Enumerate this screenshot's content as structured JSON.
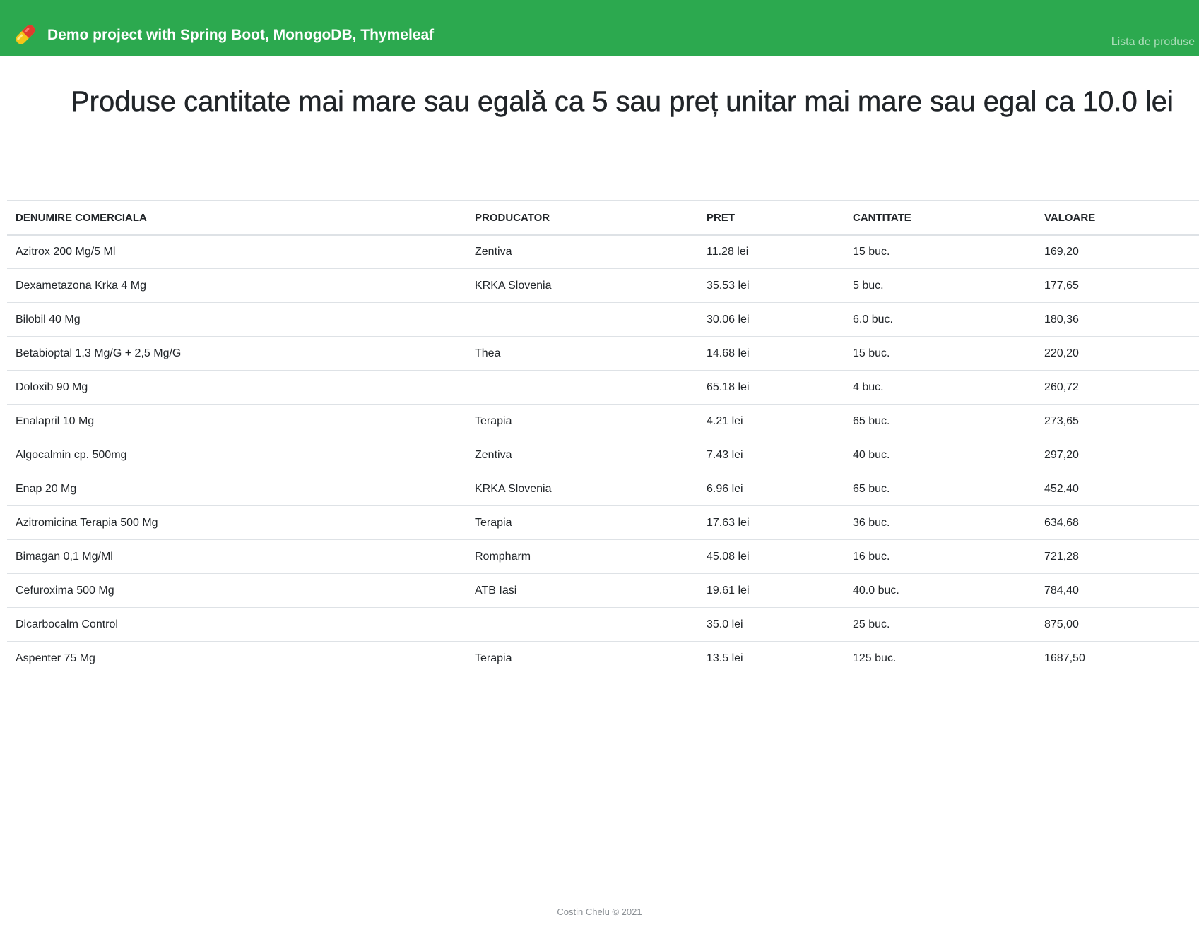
{
  "navbar": {
    "brand_icon": "pill-capsule-icon",
    "title": "Demo project with Spring Boot, MonogoDB, Thymeleaf",
    "link_label": "Lista de produse",
    "color": "#2ca94f"
  },
  "heading": "Produse cantitate mai mare sau egală ca 5 sau preț unitar mai mare sau egal ca 10.0 lei",
  "table": {
    "headers": {
      "name": "DENUMIRE COMERCIALA",
      "producer": "PRODUCATOR",
      "price": "PRET",
      "quantity": "CANTITATE",
      "value": "VALOARE"
    },
    "rows": [
      {
        "name": "Azitrox 200 Mg/5 Ml",
        "producer": "Zentiva",
        "price": "11.28 lei",
        "quantity": "15 buc.",
        "value": "169,20"
      },
      {
        "name": "Dexametazona Krka 4 Mg",
        "producer": "KRKA Slovenia",
        "price": "35.53 lei",
        "quantity": "5 buc.",
        "value": "177,65"
      },
      {
        "name": "Bilobil 40 Mg",
        "producer": "",
        "price": "30.06 lei",
        "quantity": "6.0 buc.",
        "value": "180,36"
      },
      {
        "name": "Betabioptal 1,3 Mg/G + 2,5 Mg/G",
        "producer": "Thea",
        "price": "14.68 lei",
        "quantity": "15 buc.",
        "value": "220,20"
      },
      {
        "name": "Doloxib 90 Mg",
        "producer": "",
        "price": "65.18 lei",
        "quantity": "4 buc.",
        "value": "260,72"
      },
      {
        "name": "Enalapril 10 Mg",
        "producer": "Terapia",
        "price": "4.21 lei",
        "quantity": "65 buc.",
        "value": "273,65"
      },
      {
        "name": "Algocalmin cp. 500mg",
        "producer": "Zentiva",
        "price": "7.43 lei",
        "quantity": "40 buc.",
        "value": "297,20"
      },
      {
        "name": "Enap 20 Mg",
        "producer": "KRKA Slovenia",
        "price": "6.96 lei",
        "quantity": "65 buc.",
        "value": "452,40"
      },
      {
        "name": "Azitromicina Terapia 500 Mg",
        "producer": "Terapia",
        "price": "17.63 lei",
        "quantity": "36 buc.",
        "value": "634,68"
      },
      {
        "name": "Bimagan 0,1 Mg/Ml",
        "producer": "Rompharm",
        "price": "45.08 lei",
        "quantity": "16 buc.",
        "value": "721,28"
      },
      {
        "name": "Cefuroxima 500 Mg",
        "producer": "ATB Iasi",
        "price": "19.61 lei",
        "quantity": "40.0 buc.",
        "value": "784,40"
      },
      {
        "name": "Dicarbocalm Control",
        "producer": "",
        "price": "35.0 lei",
        "quantity": "25 buc.",
        "value": "875,00"
      },
      {
        "name": "Aspenter 75 Mg",
        "producer": "Terapia",
        "price": "13.5 lei",
        "quantity": "125 buc.",
        "value": "1687,50"
      }
    ]
  },
  "footer": "Costin Chelu © 2021"
}
